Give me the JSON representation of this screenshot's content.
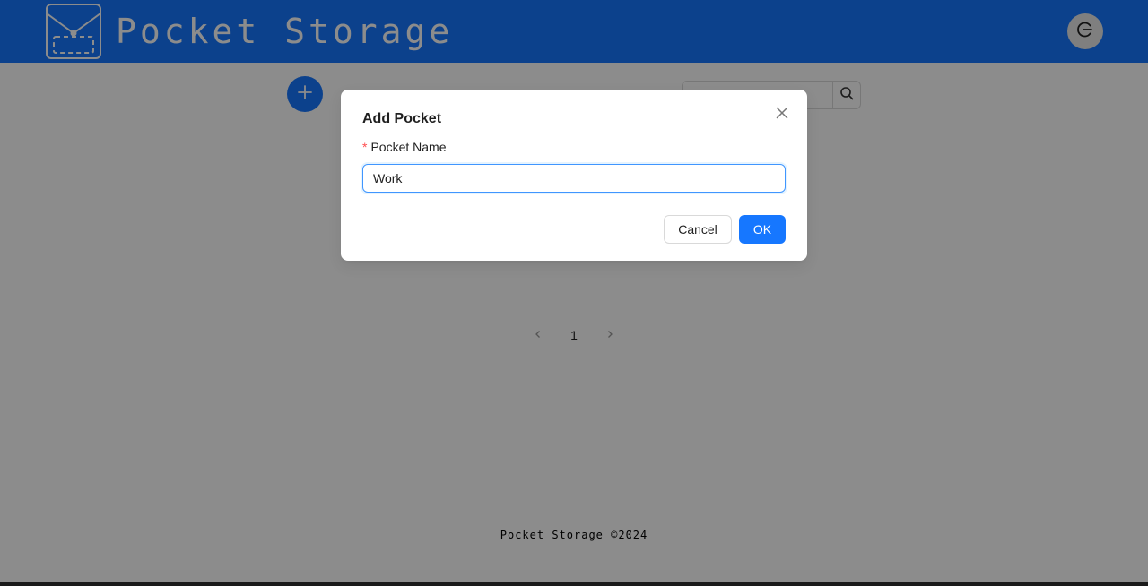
{
  "header": {
    "title": "Pocket Storage",
    "logo_icon": "pocket-envelope-icon",
    "logout_icon": "logout-icon",
    "brand_color": "#1677ff"
  },
  "toolbar": {
    "add_icon": "plus-icon",
    "search": {
      "value": "",
      "placeholder": "",
      "icon": "search-icon"
    }
  },
  "pagination": {
    "prev_icon": "chevron-left-icon",
    "next_icon": "chevron-right-icon",
    "current_page": "1"
  },
  "footer": {
    "text": "Pocket Storage ©2024"
  },
  "modal": {
    "title": "Add Pocket",
    "close_icon": "close-icon",
    "field": {
      "required_mark": "*",
      "label": "Pocket Name",
      "value": "Work"
    },
    "cancel_label": "Cancel",
    "ok_label": "OK",
    "ok_color": "#1677ff",
    "required_color": "#ff4d4f"
  }
}
